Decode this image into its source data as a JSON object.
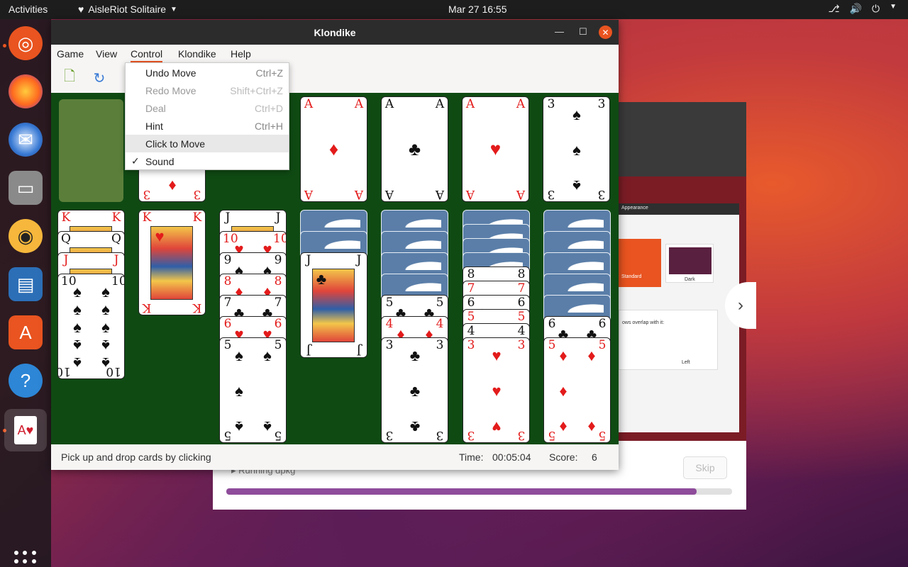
{
  "topbar": {
    "activities": "Activities",
    "app_name": "AisleRiot Solitaire",
    "clock": "Mar 27  16:55"
  },
  "window": {
    "title": "Klondike"
  },
  "menu": {
    "game": "Game",
    "view": "View",
    "control": "Control",
    "klondike": "Klondike",
    "help": "Help"
  },
  "control_menu": {
    "items": [
      {
        "label": "Undo Move",
        "accel": "Ctrl+Z",
        "enabled": true
      },
      {
        "label": "Redo Move",
        "accel": "Shift+Ctrl+Z",
        "enabled": false
      },
      {
        "label": "Deal",
        "accel": "Ctrl+D",
        "enabled": false
      },
      {
        "label": "Hint",
        "accel": "Ctrl+H",
        "enabled": true
      },
      {
        "label": "Click to Move",
        "accel": "",
        "enabled": true,
        "hover": true
      },
      {
        "label": "Sound",
        "accel": "",
        "enabled": true,
        "checked": true
      }
    ]
  },
  "status": {
    "message": "Pick up and drop cards by clicking",
    "time_label": "Time:",
    "time_value": "00:05:04",
    "score_label": "Score:",
    "score_value": "6"
  },
  "background_dialog": {
    "status": "▸ Running dpkg",
    "skip_label": "Skip",
    "progress": 0.93,
    "settings_title": "Appearance",
    "theme_standard": "Standard",
    "theme_dark": "Dark",
    "dock_position": "Left",
    "overlap_label": "ows overlap with it:"
  },
  "cards": {
    "waste_top": {
      "rank": "3",
      "suit": "♦",
      "color": "red"
    },
    "foundations": [
      {
        "rank": "A",
        "suit": "♦",
        "color": "red"
      },
      {
        "rank": "A",
        "suit": "♣",
        "color": "black"
      },
      {
        "rank": "A",
        "suit": "♥",
        "color": "red"
      },
      {
        "rank": "3",
        "suit": "♠",
        "color": "black"
      }
    ],
    "tableau_1": [
      "K♥",
      "Q♣",
      "J♥",
      "10♠"
    ],
    "tableau_2": [
      "K♥"
    ],
    "tableau_3": [
      "J♠",
      "10♥",
      "9♠",
      "8♦",
      "7♣",
      "6♥",
      "5♠"
    ],
    "tableau_4": [
      "J♣"
    ],
    "tableau_5": [
      "5♣",
      "4♦",
      "3♣"
    ],
    "tableau_6": [
      "8♠",
      "7♥",
      "6♣",
      "5♥",
      "4♠",
      "3♥"
    ],
    "tableau_7": [
      "6♣",
      "5♦"
    ]
  },
  "colors": {
    "felt": "#0f4a13",
    "accent": "#e95420",
    "card_red": "#e31b1b"
  }
}
